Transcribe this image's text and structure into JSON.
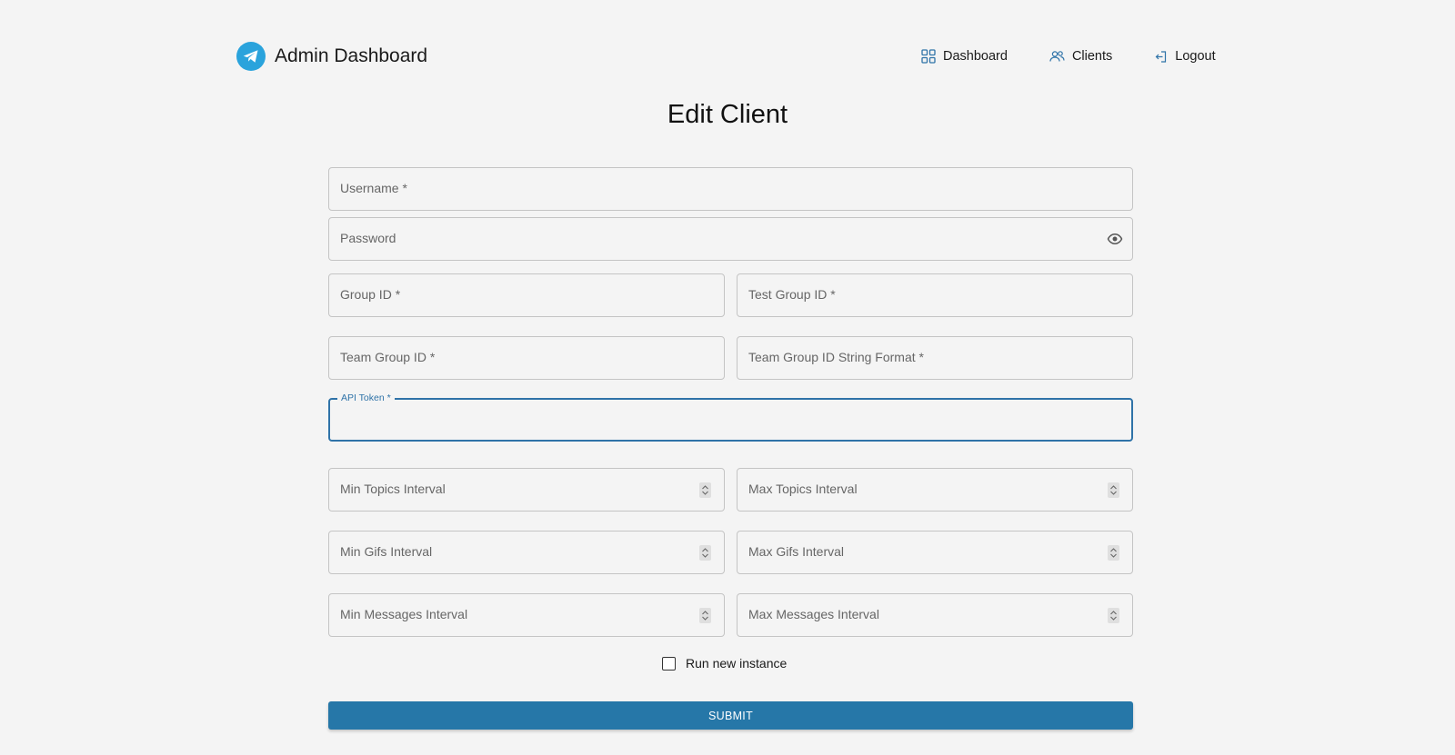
{
  "header": {
    "title": "Admin Dashboard",
    "logo_icon": "telegram-icon",
    "brand_color": "#2aa3dc",
    "nav": [
      {
        "label": "Dashboard",
        "icon": "grid-icon"
      },
      {
        "label": "Clients",
        "icon": "users-icon"
      },
      {
        "label": "Logout",
        "icon": "logout-icon"
      }
    ]
  },
  "page": {
    "title": "Edit Client"
  },
  "form": {
    "username": {
      "label": "Username *",
      "value": ""
    },
    "password": {
      "label": "Password",
      "value": "",
      "icon": "eye-icon"
    },
    "group_id": {
      "label": "Group ID *",
      "value": ""
    },
    "test_group_id": {
      "label": "Test Group ID *",
      "value": ""
    },
    "team_group_id": {
      "label": "Team Group ID *",
      "value": ""
    },
    "team_group_id_format": {
      "label": "Team Group ID String Format *",
      "value": ""
    },
    "api_token": {
      "label": "API Token *",
      "value": "",
      "focused": true
    },
    "min_topics_interval": {
      "label": "Min Topics Interval",
      "value": ""
    },
    "max_topics_interval": {
      "label": "Max Topics Interval",
      "value": ""
    },
    "min_gifs_interval": {
      "label": "Min Gifs Interval",
      "value": ""
    },
    "max_gifs_interval": {
      "label": "Max Gifs Interval",
      "value": ""
    },
    "min_messages_interval": {
      "label": "Min Messages Interval",
      "value": ""
    },
    "max_messages_interval": {
      "label": "Max Messages Interval",
      "value": ""
    },
    "run_new_instance": {
      "label": "Run new instance",
      "checked": false
    },
    "submit_label": "SUBMIT",
    "accent_color": "#2677a8"
  }
}
